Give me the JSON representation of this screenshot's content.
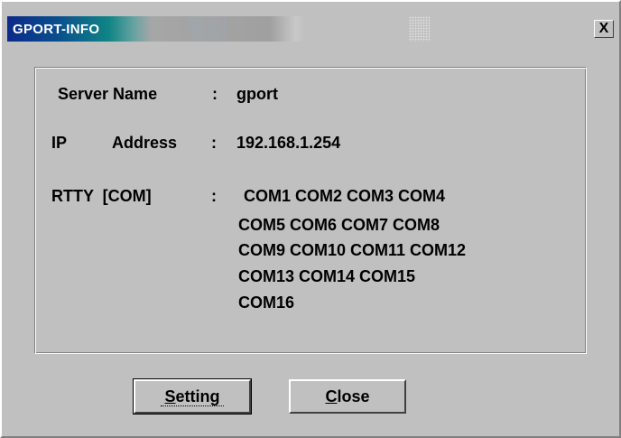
{
  "window": {
    "title": "GPORT-INFO",
    "close_glyph": "X"
  },
  "info": {
    "server_label": "Server Name",
    "server_colon": ":",
    "server_value": "gport",
    "ip_label_1": "IP",
    "ip_label_2": "Address",
    "ip_colon": ":",
    "ip_value": "192.168.1.254",
    "rtty_label": "RTTY  [COM]",
    "rtty_colon": ":",
    "com_lines": [
      "COM1 COM2 COM3 COM4",
      "COM5 COM6 COM7 COM8",
      "COM9 COM10 COM11 COM12",
      "COM13 COM14 COM15",
      "COM16"
    ]
  },
  "buttons": {
    "setting_first": "S",
    "setting_rest": "etting",
    "close_first": "C",
    "close_rest": "lose"
  }
}
